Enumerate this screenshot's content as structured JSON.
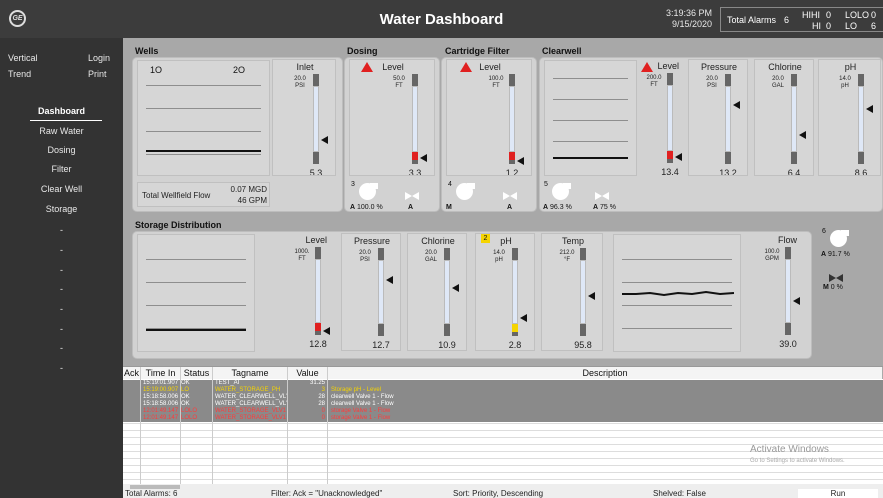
{
  "app": {
    "title": "Water Dashboard",
    "logo": "GE",
    "time": "3:19:36 PM",
    "date": "9/15/2020"
  },
  "alarms": {
    "total_label": "Total Alarms",
    "total": "6",
    "hihi_label": "HIHI",
    "hihi": "0",
    "hi_label": "HI",
    "hi": "0",
    "lolo_label": "LOLO",
    "lolo": "0",
    "lo_label": "LO",
    "lo": "6"
  },
  "sidebar": {
    "vertical": "Vertical",
    "login": "Login",
    "trend": "Trend",
    "print": "Print",
    "nav": [
      "Dashboard",
      "Raw Water",
      "Dosing",
      "Filter",
      "Clear Well",
      "Storage",
      "-",
      "-",
      "-",
      "-",
      "-",
      "-",
      "-",
      "-"
    ]
  },
  "sections": {
    "wells": "Wells",
    "dosing": "Dosing",
    "cartridge": "Cartridge Filter",
    "clearwell": "Clearwell",
    "storage": "Storage Distribution"
  },
  "wells": {
    "trend_label1": "1",
    "trend_label2": "2",
    "flow_label": "Total Wellfield Flow",
    "flow_mgd": "0.07 MGD",
    "flow_gpm": "46 GPM"
  },
  "gauges": [
    {
      "title": "Inlet",
      "scale": "20.0\nPSI",
      "value": "5.3",
      "level": 0.27,
      "alarm": false
    },
    {
      "title": "Level",
      "scale": "50.0\nFT",
      "value": "3.3",
      "level": 0.07,
      "alarm": true
    },
    {
      "title": "Level",
      "scale": "100.0\nFT",
      "value": "1.2",
      "level": 0.03,
      "alarm": true
    },
    {
      "title": "Level",
      "scale": "200.0\nFT",
      "value": "13.4",
      "level": 0.07,
      "alarm": true
    },
    {
      "title": "Pressure",
      "scale": "20.0\nPSI",
      "value": "13.2",
      "level": 0.66,
      "alarm": false
    },
    {
      "title": "Chlorine",
      "scale": "20.0\nGAL",
      "value": "6.4",
      "level": 0.32,
      "alarm": false
    },
    {
      "title": "pH",
      "scale": "14.0\npH",
      "value": "8.6",
      "level": 0.61,
      "alarm": false
    },
    {
      "title": "Level",
      "scale": "1000.\nFT",
      "value": "12.8",
      "level": 0.05,
      "alarm": true
    },
    {
      "title": "Pressure",
      "scale": "20.0\nPSI",
      "value": "12.7",
      "level": 0.64,
      "alarm": false
    },
    {
      "title": "Chlorine",
      "scale": "20.0\nGAL",
      "value": "10.9",
      "level": 0.54,
      "alarm": false
    },
    {
      "title": "pH",
      "scale": "14.0\npH",
      "value": "2.8",
      "level": 0.2,
      "alarm": "yellow"
    },
    {
      "title": "Temp",
      "scale": "212.0\n°F",
      "value": "95.8",
      "level": 0.45,
      "alarm": false
    },
    {
      "title": "Flow",
      "scale": "100.0\nGPM",
      "value": "39.0",
      "level": 0.39,
      "alarm": false
    }
  ],
  "equipment": {
    "dosing_pump_num": "3",
    "dosing_pump_mode": "A",
    "dosing_pump_speed": "100.0",
    "dosing_pump_unit": "%",
    "dosing_valve_mode": "A",
    "cart_pump_num": "4",
    "cart_pump_mode": "M",
    "cart_valve_mode": "A",
    "cw_pump_num": "5",
    "cw_pump_mode": "A",
    "cw_pump_speed": "96.3",
    "cw_pump_unit": "%",
    "cw_valve_mode": "A",
    "cw_valve_pct": "75",
    "cw_valve_unit": "%",
    "st_pump_num": "6",
    "st_pump_mode": "A",
    "st_pump_speed": "91.7",
    "st_pump_unit": "%",
    "st_valve_mode": "M",
    "st_valve_pct": "0",
    "st_valve_unit": "%"
  },
  "badge": "2",
  "alarm_grid": {
    "headers": [
      "Ack",
      "Time In",
      "Status",
      "Tagname",
      "Value",
      "Description"
    ],
    "rows": [
      {
        "time": "15:19:01.907",
        "status": "OK",
        "tag": "TEST_AI",
        "value": "31.25",
        "desc": "",
        "color": "#ffffff"
      },
      {
        "time": "15:19:00.907",
        "status": "LO",
        "tag": "WATER_STORAGE_PH",
        "value": "3",
        "desc": "Storage pH - Level",
        "color": "#f5d400"
      },
      {
        "time": "15:18:58.006",
        "status": "OK",
        "tag": "WATER_CLEARWELL_VL'",
        "value": "28",
        "desc": "clearwell Valve 1 - Flow",
        "color": "#ffffff"
      },
      {
        "time": "15:18:58.006",
        "status": "OK",
        "tag": "WATER_CLEARWELL_VL'",
        "value": "28",
        "desc": "clearwell Valve 1 - Flow",
        "color": "#ffffff"
      },
      {
        "time": "12:01:49.147",
        "status": "LOLO",
        "tag": "WATER_STORAGE_VLV1",
        "value": "0",
        "desc": "storage Valve 1 - Flow",
        "color": "#ff3b3b"
      },
      {
        "time": "12:01:49.147",
        "status": "LOLO",
        "tag": "WATER_STORAGE_VLV1",
        "value": "0",
        "desc": "storage Valve 1 - Flow",
        "color": "#ff3b3b"
      }
    ]
  },
  "watermark": {
    "title": "Activate Windows",
    "sub": "Go to Settings to activate Windows."
  },
  "statusbar": {
    "total": "Total Alarms: 6",
    "filter": "Filter: Ack = \"Unacknowledged\"",
    "sort": "Sort: Priority, Descending",
    "shelved": "Shelved: False",
    "run": "Run"
  }
}
